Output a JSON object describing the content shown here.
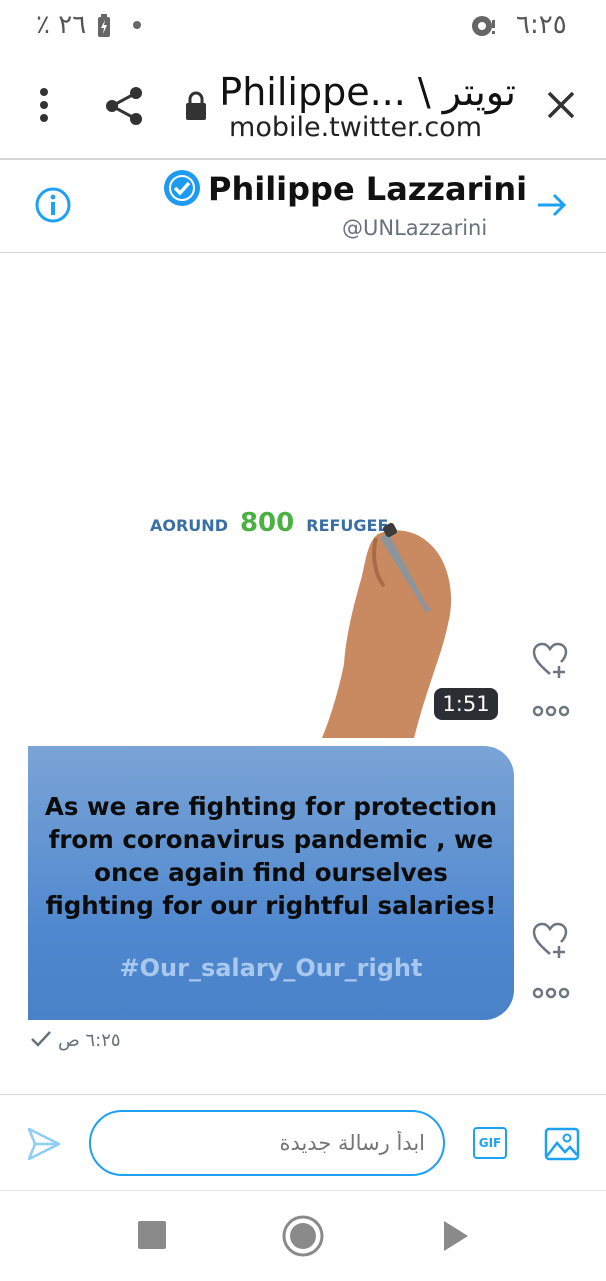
{
  "status_bar": {
    "battery": "٪ ٢٦",
    "time": "٦:٢٥"
  },
  "browser": {
    "title": "Philippe... \\ تويتر",
    "host": "mobile.twitter.com"
  },
  "conversation": {
    "name": "Philippe Lazzarini",
    "handle": "@UNLazzarini"
  },
  "video": {
    "text_left": "AORUND",
    "text_number": "800",
    "text_right": "REFUGEE",
    "duration": "1:51"
  },
  "image_message": {
    "lines": [
      "As we are fighting for protection",
      "from coronavirus pandemic , we",
      "once again find ourselves",
      "fighting for our rightful salaries!"
    ],
    "hashtag": "#Our_salary_Our_right"
  },
  "timestamp": "٦:٢٥ ص",
  "composer": {
    "placeholder": "ابدأ رسالة جديدة",
    "gif_label": "GIF"
  },
  "colors": {
    "accent": "#1da1f2",
    "verified": "#1d9bf0"
  }
}
